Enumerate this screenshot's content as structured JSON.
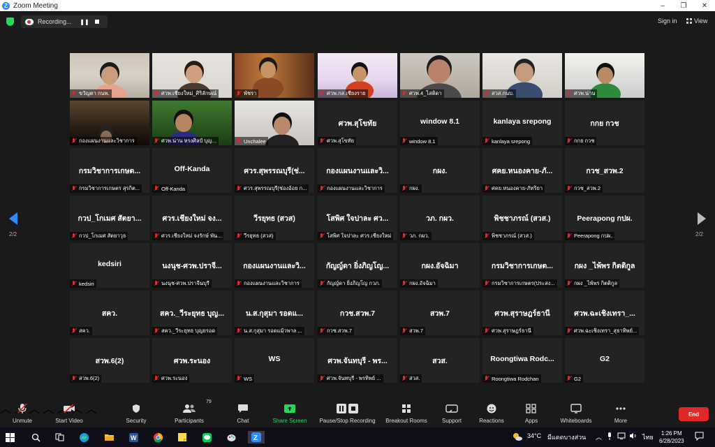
{
  "window": {
    "title": "Zoom Meeting",
    "minimize": "–",
    "restore": "❐",
    "close": "✕"
  },
  "topbar": {
    "recording_label": "Recording...",
    "pause_glyph": "❚❚",
    "sign_in": "Sign in",
    "view_label": "View"
  },
  "pagination": {
    "left": "2/2",
    "right": "2/2"
  },
  "tiles": [
    {
      "big": "",
      "name": "ขวัญตา กนพ.",
      "video": "person1"
    },
    {
      "big": "",
      "name": "ศวพ.เชียงใหม่_ศิริลักษณ์",
      "video": "person2"
    },
    {
      "big": "",
      "name": "พัชรา",
      "video": "person3"
    },
    {
      "big": "",
      "name": "ศวพ.กส.เชียงราย",
      "video": "poster"
    },
    {
      "big": "",
      "name": "ศวพ.4_ไสติดา",
      "video": "person4"
    },
    {
      "big": "",
      "name": "สวส.กนบ.",
      "video": "person5"
    },
    {
      "big": "",
      "name": "ศวพ.น่าน",
      "video": "person6"
    },
    {
      "big": "",
      "name": "กองแผนงานและวิชาการ",
      "video": "room"
    },
    {
      "big": "",
      "name": "ศวพ.น่าน หรงศิลป์ บุญ...",
      "video": "person7"
    },
    {
      "big": "",
      "name": "Unchalee",
      "video": "person8"
    },
    {
      "big": "ศวพ.สุโขทัย",
      "name": "ศวพ.สุโขทัย",
      "video": ""
    },
    {
      "big": "window 8.1",
      "name": "window 8.1",
      "video": ""
    },
    {
      "big": "kanlaya srepong",
      "name": "kanlaya srepong",
      "video": ""
    },
    {
      "big": "กกย กวช",
      "name": "กกย กวช",
      "video": ""
    },
    {
      "big": "กรมวิชาการเกษต...",
      "name": "กรมวิชาการเกษตร สุรกิต...",
      "video": ""
    },
    {
      "big": "Off-Kanda",
      "name": "Off-Kanda",
      "video": ""
    },
    {
      "big": "ศวร.สุพรรณบุรี(ช่...",
      "name": "ศวร.สุพรรณบุรี(ช่องอ้อย ก...",
      "video": ""
    },
    {
      "big": "กองแผนงานและวิ...",
      "name": "กองแผนงานและวิชาการ",
      "video": ""
    },
    {
      "big": "กผง.",
      "name": "กผง.",
      "video": ""
    },
    {
      "big": "ศคย.หนองคาย-ภั...",
      "name": "ศคย.หนองคาย-ภัทริยา",
      "video": ""
    },
    {
      "big": "กวช_สวพ.2",
      "name": "กวช_สวพ.2",
      "video": ""
    },
    {
      "big": "กวป_โกเมศ สัตยา...",
      "name": "กวป_โกเมศ สัตยาวุธ",
      "video": ""
    },
    {
      "big": "ศวร.เชียงใหม่ จง...",
      "name": "ศวร.เชียงใหม่ จงรักษ์ พัน...",
      "video": ""
    },
    {
      "big": "วีรยุทธ (สวส)",
      "name": "วีรยุทธ (สวส)",
      "video": ""
    },
    {
      "big": "โสพิศ ใจปาละ ศว...",
      "name": "โสพิศ ใจปาละ ศวร.เชียงใหม่",
      "video": ""
    },
    {
      "big": "วภ. กผว.",
      "name": "วภ. กผว.",
      "video": ""
    },
    {
      "big": "พิชชาภรณ์ (สวส.)",
      "name": "พิชชาภรณ์ (สวส.)",
      "video": ""
    },
    {
      "big": "Peerapong กปผ.",
      "name": "Peerapong กปผ.",
      "video": ""
    },
    {
      "big": "kedsiri",
      "name": "kedsiri",
      "video": ""
    },
    {
      "big": "นงนุช-ศวพ.ปราจี...",
      "name": "นงนุช-ศวพ.ปราจีนบุรี",
      "video": ""
    },
    {
      "big": "กองแผนงานและวิ...",
      "name": "กองแผนงานและวิชาการ",
      "video": ""
    },
    {
      "big": "กัญญ์ดา ยิ่งภิญโญ...",
      "name": "กัญญ์ดา ยิ่งภิญโญ กวภ.",
      "video": ""
    },
    {
      "big": "กผง.อัจฉิมา",
      "name": "กผง.อัจฉิมา",
      "video": ""
    },
    {
      "big": "กรมวิชาการเกษต...",
      "name": "กรมวิชาการเกษตร(ประสง...",
      "video": ""
    },
    {
      "big": "กผง _ไพ้พร กิตติกูล",
      "name": "กผง _ไพ้พร กิตติกูล",
      "video": ""
    },
    {
      "big": "สคว.",
      "name": "สคว.",
      "video": ""
    },
    {
      "big": "สคว._วีระยุทธ บุญ...",
      "name": "สคว._วีระยุทธ บุญยรอด",
      "video": ""
    },
    {
      "big": "น.ส.กุสุมา รอดแ...",
      "name": "น.ส.กุสุมา รอดแม้วพาล ...",
      "video": ""
    },
    {
      "big": "กวช.สวพ.7",
      "name": "กวช.สวพ.7",
      "video": ""
    },
    {
      "big": "สวพ.7",
      "name": "สวพ.7",
      "video": ""
    },
    {
      "big": "ศวพ.สุราษฎร์ธานี",
      "name": "ศวพ.สุราษฎร์ธานี",
      "video": ""
    },
    {
      "big": "ศวพ.ฉะเชิงเทรา_...",
      "name": "ศวพ.ฉะเชิงเทรา_สุธาทิพย์...",
      "video": ""
    },
    {
      "big": "สวพ.6(2)",
      "name": "สวพ.6(2)",
      "video": ""
    },
    {
      "big": "ศวพ.ระนอง",
      "name": "ศวพ.ระนอง",
      "video": ""
    },
    {
      "big": "WS",
      "name": "WS",
      "video": ""
    },
    {
      "big": "ศวพ.จันทบุรี - พร...",
      "name": "ศวพ.จันทบุรี - พรทิพย์ ...",
      "video": ""
    },
    {
      "big": "สวส.",
      "name": "สวส.",
      "video": ""
    },
    {
      "big": "Roongtiwa  Rodc...",
      "name": "Roongtiwa Rodchan",
      "video": ""
    },
    {
      "big": "G2",
      "name": "G2",
      "video": ""
    }
  ],
  "toolbar": {
    "unmute": "Unmute",
    "start_video": "Start Video",
    "security": "Security",
    "participants": "Participants",
    "participants_count": "79",
    "chat": "Chat",
    "share_screen": "Share Screen",
    "pause_stop_recording": "Pause/Stop Recording",
    "breakout_rooms": "Breakout Rooms",
    "support": "Support",
    "reactions": "Reactions",
    "apps": "Apps",
    "whiteboards": "Whiteboards",
    "more": "More",
    "end": "End"
  },
  "taskbar": {
    "weather": "34°C",
    "weather_desc": "มีแดดบางส่วน",
    "lang": "ไทย",
    "time": "1:26 PM",
    "date": "6/28/2023"
  },
  "colors": {
    "accent": "#2d8cff",
    "end_red": "#e02828",
    "green": "#23d959",
    "tile_bg": "#232323"
  }
}
